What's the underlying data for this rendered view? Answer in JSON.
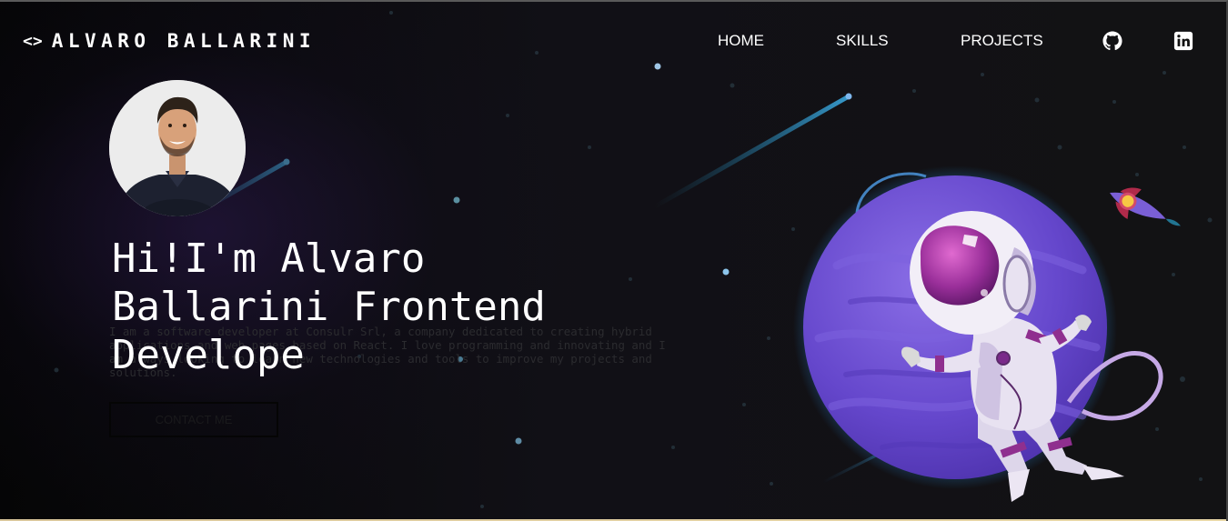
{
  "brand": {
    "icon": "code-brackets-icon",
    "name": "ALVARO BALLARINI"
  },
  "nav": {
    "links": [
      "HOME",
      "SKILLS",
      "PROJECTS"
    ],
    "social": [
      "github-icon",
      "linkedin-icon"
    ]
  },
  "hero": {
    "title": "Hi!I'm Alvaro Ballarini Frontend Develope",
    "description": "I am a software developer at Consulr Srl, a company dedicated to creating hybrid applications and web pages based on React. I love programming and innovating and I am always looking to learn new technologies and tools to improve my projects and solutions.",
    "contact_label": "CONTACT ME"
  },
  "colors": {
    "background": "#121214",
    "text": "#ffffff",
    "planet": "#6a4fd0",
    "accent_glow": "#2aa0e8"
  }
}
